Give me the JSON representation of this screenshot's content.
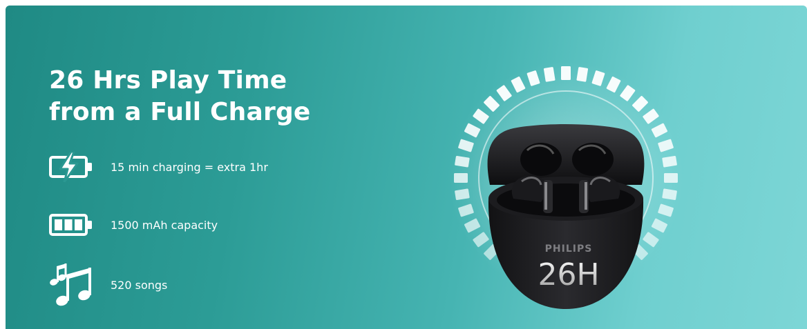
{
  "headline": {
    "line1": "26 Hrs Play Time",
    "line2": "from a Full Charge"
  },
  "features": [
    {
      "icon": "battery-charging-icon",
      "text": "15 min charging = extra 1hr"
    },
    {
      "icon": "battery-full-icon",
      "text": "1500 mAh capacity"
    },
    {
      "icon": "music-notes-icon",
      "text": "520 songs"
    }
  ],
  "product": {
    "brand": "PHILIPS",
    "model_mark": "26H"
  },
  "colors": {
    "gradient_start": "#1f8a84",
    "gradient_end": "#7dd6d6",
    "text": "#ffffff",
    "case": "#1b1b1d"
  }
}
